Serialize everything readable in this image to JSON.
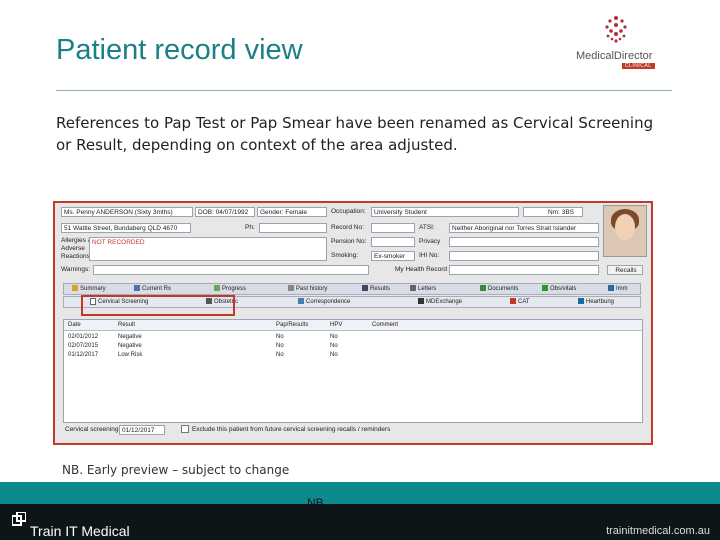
{
  "slide": {
    "title": "Patient record view",
    "body": "References to Pap Test or Pap Smear have been renamed as Cervical Screening or Result, depending on context of the area adjusted.",
    "note": "NB. Early preview – subject to change",
    "footer_nb": "NB",
    "footer_brand": "Train IT Medical",
    "footer_url": "trainitmedical.com.au"
  },
  "logo": {
    "text": "MedicalDirector",
    "badge": "CLINICAL"
  },
  "patient": {
    "name": "Ms. Penny ANDERSON (Sixty 3mths)",
    "dob": "DOB: 04/07/1992",
    "gender": "Gender: Female",
    "address": "51 Wattle Street, Bundaberg  QLD 4670",
    "ph_label": "Ph:",
    "allergies_label": "Allergies &",
    "adverse_label": "Adverse",
    "reactions_label": "Reactions:",
    "allergies_value": "NOT RECORDED",
    "warnings_label": "Warnings:",
    "occupation_label": "Occupation:",
    "occupation_value": "University Student",
    "record_label": "Record No:",
    "pension_label": "Pension No:",
    "smoking_label": "Smoking:",
    "smoking_value": "Ex-smoker",
    "ats_label": "ATSI:",
    "ats_value": "Neither Aboriginal nor Torres Strait Islander",
    "privacy_label": "Privacy",
    "ihi_label": "IHI No:",
    "myhealth_label": "My Health Record",
    "recalls_label": "Recalls",
    "age_value": "Nm: 3BS"
  },
  "tabs_row1": [
    "Summary",
    "Current Rx",
    "Progress",
    "Past history",
    "Results",
    "Letters",
    "Documents",
    "Obs/vitals",
    "Imm"
  ],
  "tabs_row2": [
    "Cervical Screening",
    "Obstetric",
    "Correspondence",
    "MDExchange",
    "CAT",
    "Heartbung"
  ],
  "table": {
    "headers": [
      "Date",
      "Result",
      "Pap/Results",
      "HPV",
      "Comment"
    ],
    "rows": [
      [
        "02/01/2012",
        "Negative",
        "No",
        "No",
        ""
      ],
      [
        "02/07/2015",
        "Negative",
        "No",
        "No",
        ""
      ],
      [
        "01/12/2017",
        "Low Risk",
        "No",
        "No",
        ""
      ]
    ]
  },
  "bottom": {
    "due_label": "Cervical screening due:",
    "due_value": "01/12/2017",
    "exclude_label": "Exclude this patient from future cervical screening recalls / reminders"
  },
  "colors": {
    "title": "#1a7f87",
    "highlight": "#c0392b",
    "footer_band": "#0e8a8f"
  }
}
